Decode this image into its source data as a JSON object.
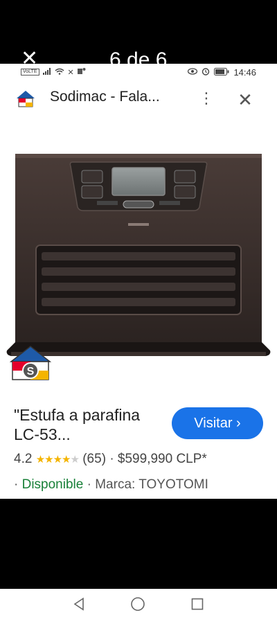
{
  "overlay": {
    "close_glyph": "✕",
    "counter": "6 de 6"
  },
  "status_bar": {
    "volte": "VoLTE",
    "time": "14:46"
  },
  "browser": {
    "site_title": "Sodimac - Fala...",
    "menu_glyph": "⋮",
    "close_glyph": "✕"
  },
  "product": {
    "title": "\"Estufa a parafina LC-53...",
    "visit_label": "Visitar ›",
    "rating": "4.2",
    "rating_value": 4.2,
    "reviews": "(65)",
    "separator": "·",
    "price": "$599,990 CLP*",
    "availability": "Disponible",
    "brand": "Marca: TOYOTOMI",
    "badge_letter": "S"
  },
  "colors": {
    "accent": "#1a73e8",
    "available": "#188038",
    "star": "#f4b400"
  }
}
